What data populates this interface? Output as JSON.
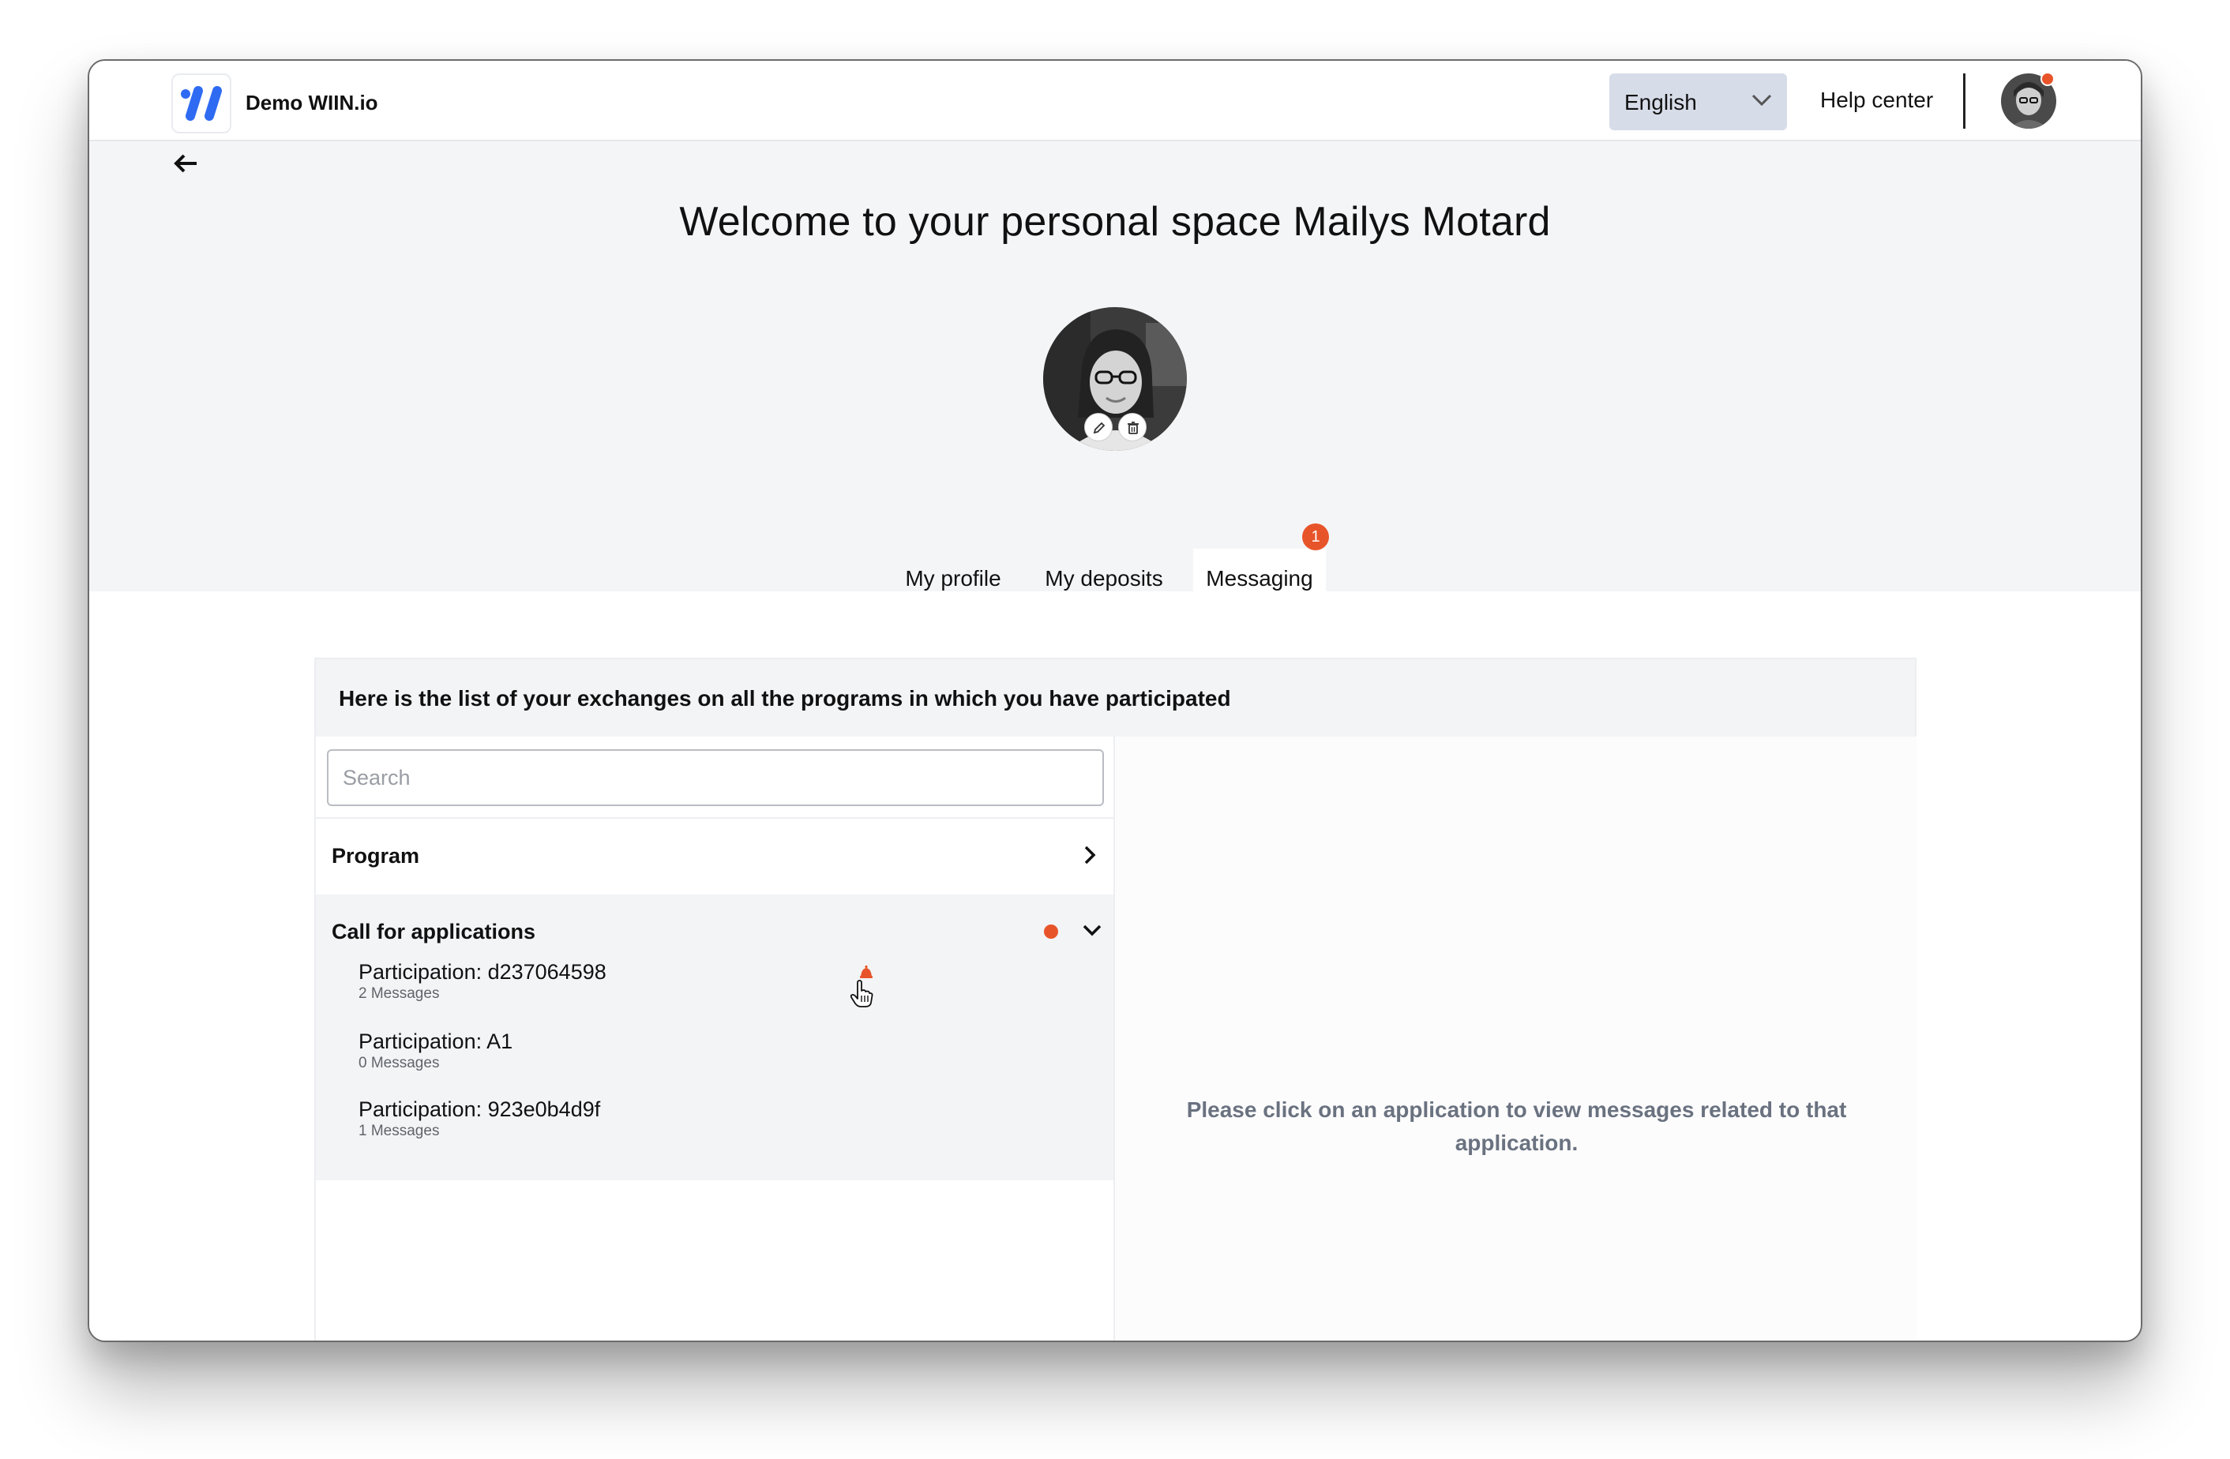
{
  "header": {
    "app_name": "Demo WIIN.io",
    "language": "English",
    "help_link": "Help center",
    "colors": {
      "accent": "#2f6bf2",
      "notification": "#e8542a"
    }
  },
  "page": {
    "title": "Welcome to your personal space Mailys Motard"
  },
  "tabs": [
    {
      "label": "My profile"
    },
    {
      "label": "My deposits"
    },
    {
      "label": "Messaging",
      "badge": "1",
      "active": true
    }
  ],
  "messaging": {
    "intro": "Here is the list of your exchanges on all the programs in which you have participated",
    "search": {
      "placeholder": "Search",
      "value": ""
    },
    "groups": [
      {
        "label": "Program",
        "expanded": false
      },
      {
        "label": "Call for applications",
        "expanded": true,
        "unread": true,
        "items": [
          {
            "title": "Participation: d237064598",
            "count": "2 Messages",
            "notification": true
          },
          {
            "title": "Participation: A1",
            "count": "0 Messages"
          },
          {
            "title": "Participation: 923e0b4d9f",
            "count": "1 Messages"
          }
        ]
      }
    ],
    "empty_state": "Please click on an application to view messages related to that application."
  }
}
